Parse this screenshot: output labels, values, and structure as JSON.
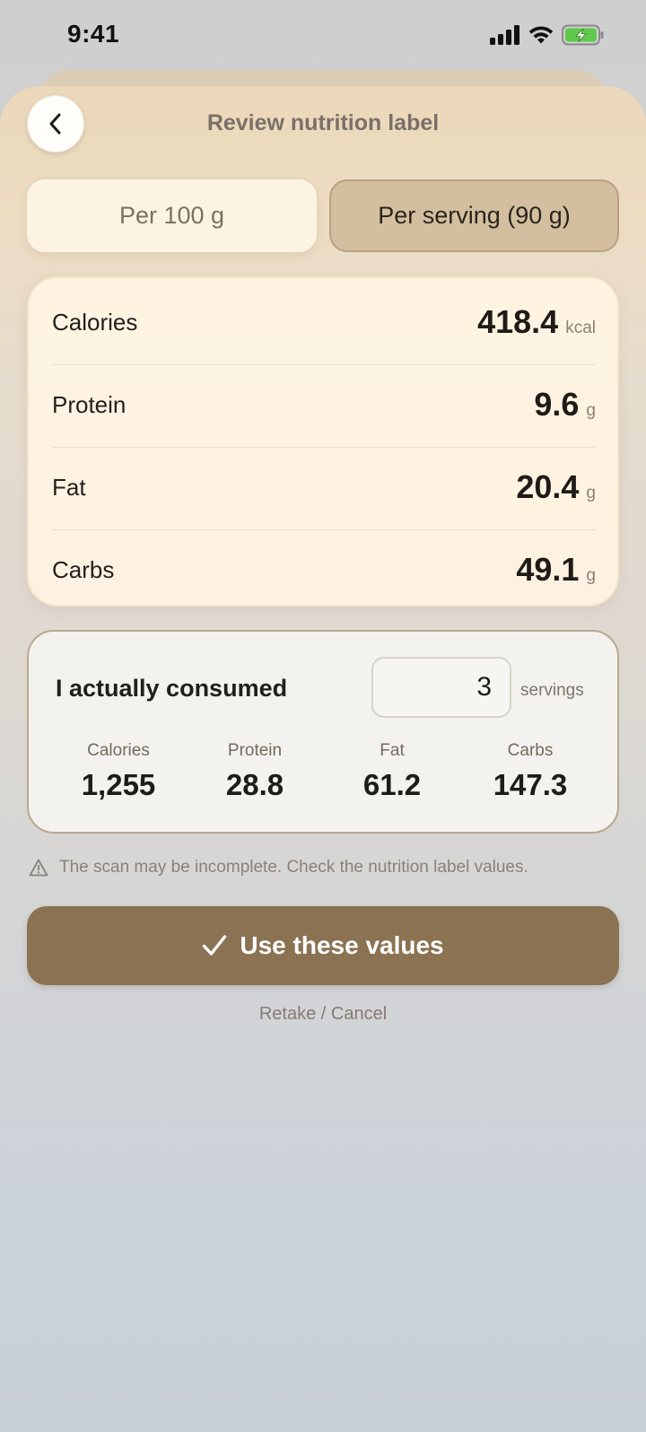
{
  "status_bar": {
    "time": "9:41"
  },
  "header": {
    "title": "Review nutrition label",
    "back_icon": "chevron-left-icon"
  },
  "toggle": {
    "per_100g": "Per 100 g",
    "per_serving": "Per serving (90 g)",
    "selected": "per_serving"
  },
  "nutrition": {
    "rows": [
      {
        "label": "Calories",
        "value": "418.4",
        "unit": "kcal"
      },
      {
        "label": "Protein",
        "value": "9.6",
        "unit": "g"
      },
      {
        "label": "Fat",
        "value": "20.4",
        "unit": "g"
      },
      {
        "label": "Carbs",
        "value": "49.1",
        "unit": "g"
      }
    ]
  },
  "consumed": {
    "label": "I actually consumed",
    "servings": "3",
    "servings_unit": "servings",
    "totals": [
      {
        "label": "Calories",
        "value": "1,255"
      },
      {
        "label": "Protein",
        "value": "28.8"
      },
      {
        "label": "Fat",
        "value": "61.2"
      },
      {
        "label": "Carbs",
        "value": "147.3"
      }
    ]
  },
  "warning": {
    "icon": "warning-triangle-icon",
    "text": "The scan may be incomplete. Check the nutrition label values."
  },
  "actions": {
    "primary_label": "Use these values",
    "primary_icon": "checkmark-icon",
    "secondary_label": "Retake / Cancel"
  },
  "colors": {
    "accent": "#8b7252",
    "selected_segment": "#d3bf9f",
    "card_bg": "#fff4e2",
    "battery_green": "#5fc94e"
  }
}
